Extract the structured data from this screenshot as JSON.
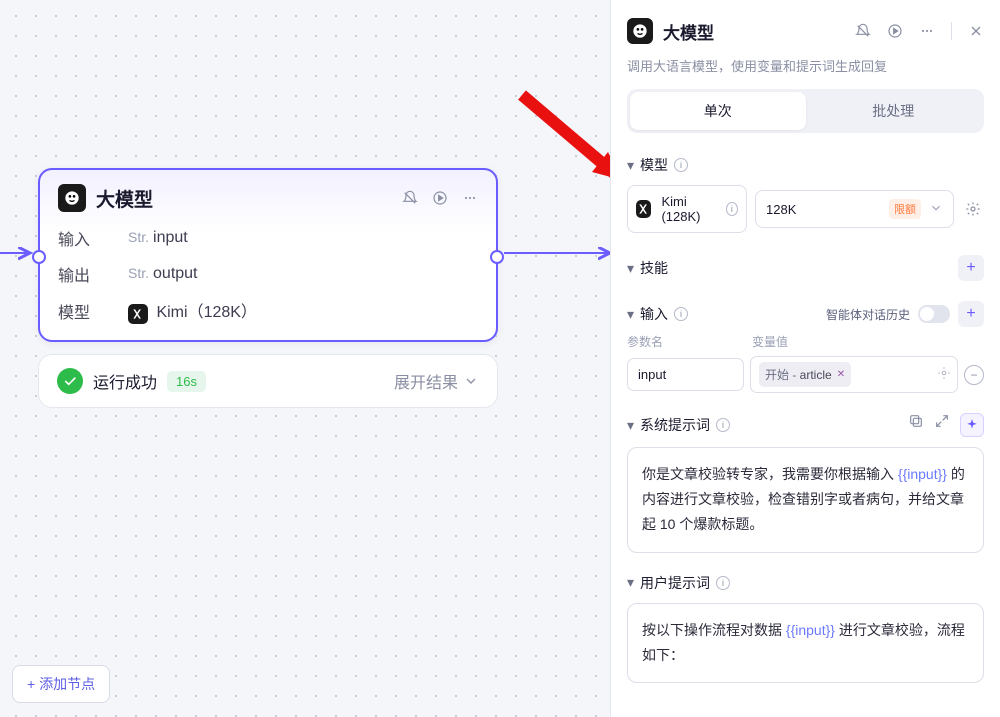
{
  "canvas": {
    "node": {
      "title": "大模型",
      "input_label": "输入",
      "input_type": "Str.",
      "input_name": "input",
      "output_label": "输出",
      "output_type": "Str.",
      "output_name": "output",
      "model_label": "模型",
      "model_value": "Kimi（128K）"
    },
    "result": {
      "status": "运行成功",
      "duration": "16s",
      "expand": "展开结果"
    },
    "add_node": "添加节点"
  },
  "panel": {
    "title": "大模型",
    "desc": "调用大语言模型，使用变量和提示词生成回复",
    "tabs": {
      "single": "单次",
      "batch": "批处理"
    },
    "model_section": "模型",
    "model_name": "Kimi (128K)",
    "context_size": "128K",
    "limit_badge": "限额",
    "skill_section": "技能",
    "input_section": "输入",
    "history_label": "智能体对话历史",
    "col_param": "参数名",
    "col_value": "变量值",
    "param_name": "input",
    "chip_prefix": "开始 - ",
    "chip_value": "article",
    "sys_prompt_section": "系统提示词",
    "sys_prompt_pre": "你是文章校验转专家，我需要你根据输入 ",
    "sys_prompt_var": "{{input}}",
    "sys_prompt_post": " 的内容进行文章校验，检查错别字或者病句，并给文章起 10 个爆款标题。",
    "user_prompt_section": "用户提示词",
    "user_prompt_pre": "按以下操作流程对数据 ",
    "user_prompt_var": "{{input}}",
    "user_prompt_post": " 进行文章校验，流程如下："
  }
}
